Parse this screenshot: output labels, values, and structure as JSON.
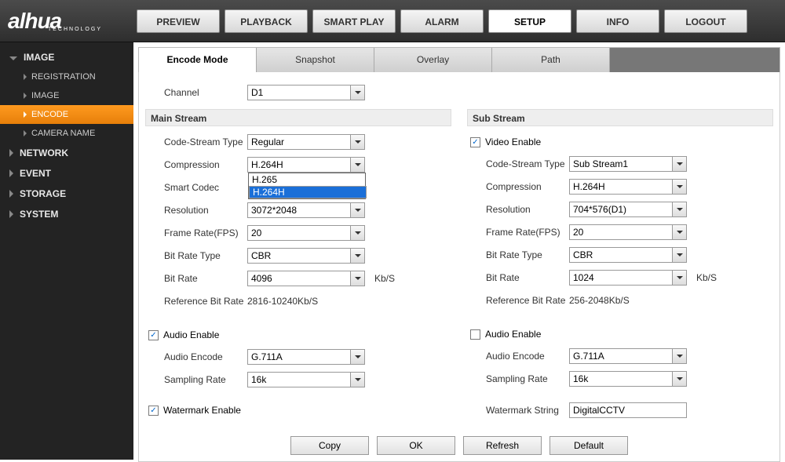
{
  "logo": "alhua",
  "logo_sub": "TECHNOLOGY",
  "topnav": [
    "PREVIEW",
    "PLAYBACK",
    "SMART PLAY",
    "ALARM",
    "SETUP",
    "INFO",
    "LOGOUT"
  ],
  "topnav_active": 4,
  "sidebar": {
    "cats": [
      {
        "label": "IMAGE",
        "open": true,
        "items": [
          "REGISTRATION",
          "IMAGE",
          "ENCODE",
          "CAMERA NAME"
        ],
        "active": 2
      },
      {
        "label": "NETWORK",
        "open": false
      },
      {
        "label": "EVENT",
        "open": false
      },
      {
        "label": "STORAGE",
        "open": false
      },
      {
        "label": "SYSTEM",
        "open": false
      }
    ]
  },
  "subtabs": [
    "Encode Mode",
    "Snapshot",
    "Overlay",
    "Path"
  ],
  "subtabs_active": 0,
  "channel_label": "Channel",
  "channel_value": "D1",
  "main": {
    "header": "Main Stream",
    "code_stream_type_label": "Code-Stream Type",
    "code_stream_type_value": "Regular",
    "compression_label": "Compression",
    "compression_value": "H.264H",
    "compression_options": [
      "H.265",
      "H.264H"
    ],
    "compression_selected_option": 1,
    "smart_codec_label": "Smart Codec",
    "resolution_label": "Resolution",
    "resolution_value": "3072*2048",
    "frame_rate_label": "Frame Rate(FPS)",
    "frame_rate_value": "20",
    "bit_rate_type_label": "Bit Rate Type",
    "bit_rate_type_value": "CBR",
    "bit_rate_label": "Bit Rate",
    "bit_rate_value": "4096",
    "bit_rate_unit": "Kb/S",
    "ref_bit_rate_label": "Reference Bit Rate",
    "ref_bit_rate_value": "2816-10240Kb/S",
    "audio_enable_label": "Audio Enable",
    "audio_enable_checked": true,
    "audio_encode_label": "Audio Encode",
    "audio_encode_value": "G.711A",
    "sampling_rate_label": "Sampling Rate",
    "sampling_rate_value": "16k"
  },
  "sub": {
    "header": "Sub Stream",
    "video_enable_label": "Video Enable",
    "video_enable_checked": true,
    "code_stream_type_label": "Code-Stream Type",
    "code_stream_type_value": "Sub Stream1",
    "compression_label": "Compression",
    "compression_value": "H.264H",
    "resolution_label": "Resolution",
    "resolution_value": "704*576(D1)",
    "frame_rate_label": "Frame Rate(FPS)",
    "frame_rate_value": "20",
    "bit_rate_type_label": "Bit Rate Type",
    "bit_rate_type_value": "CBR",
    "bit_rate_label": "Bit Rate",
    "bit_rate_value": "1024",
    "bit_rate_unit": "Kb/S",
    "ref_bit_rate_label": "Reference Bit Rate",
    "ref_bit_rate_value": "256-2048Kb/S",
    "audio_enable_label": "Audio Enable",
    "audio_enable_checked": false,
    "audio_encode_label": "Audio Encode",
    "audio_encode_value": "G.711A",
    "sampling_rate_label": "Sampling Rate",
    "sampling_rate_value": "16k"
  },
  "watermark": {
    "enable_label": "Watermark Enable",
    "enable_checked": true,
    "string_label": "Watermark String",
    "string_value": "DigitalCCTV"
  },
  "buttons": [
    "Copy",
    "OK",
    "Refresh",
    "Default"
  ]
}
